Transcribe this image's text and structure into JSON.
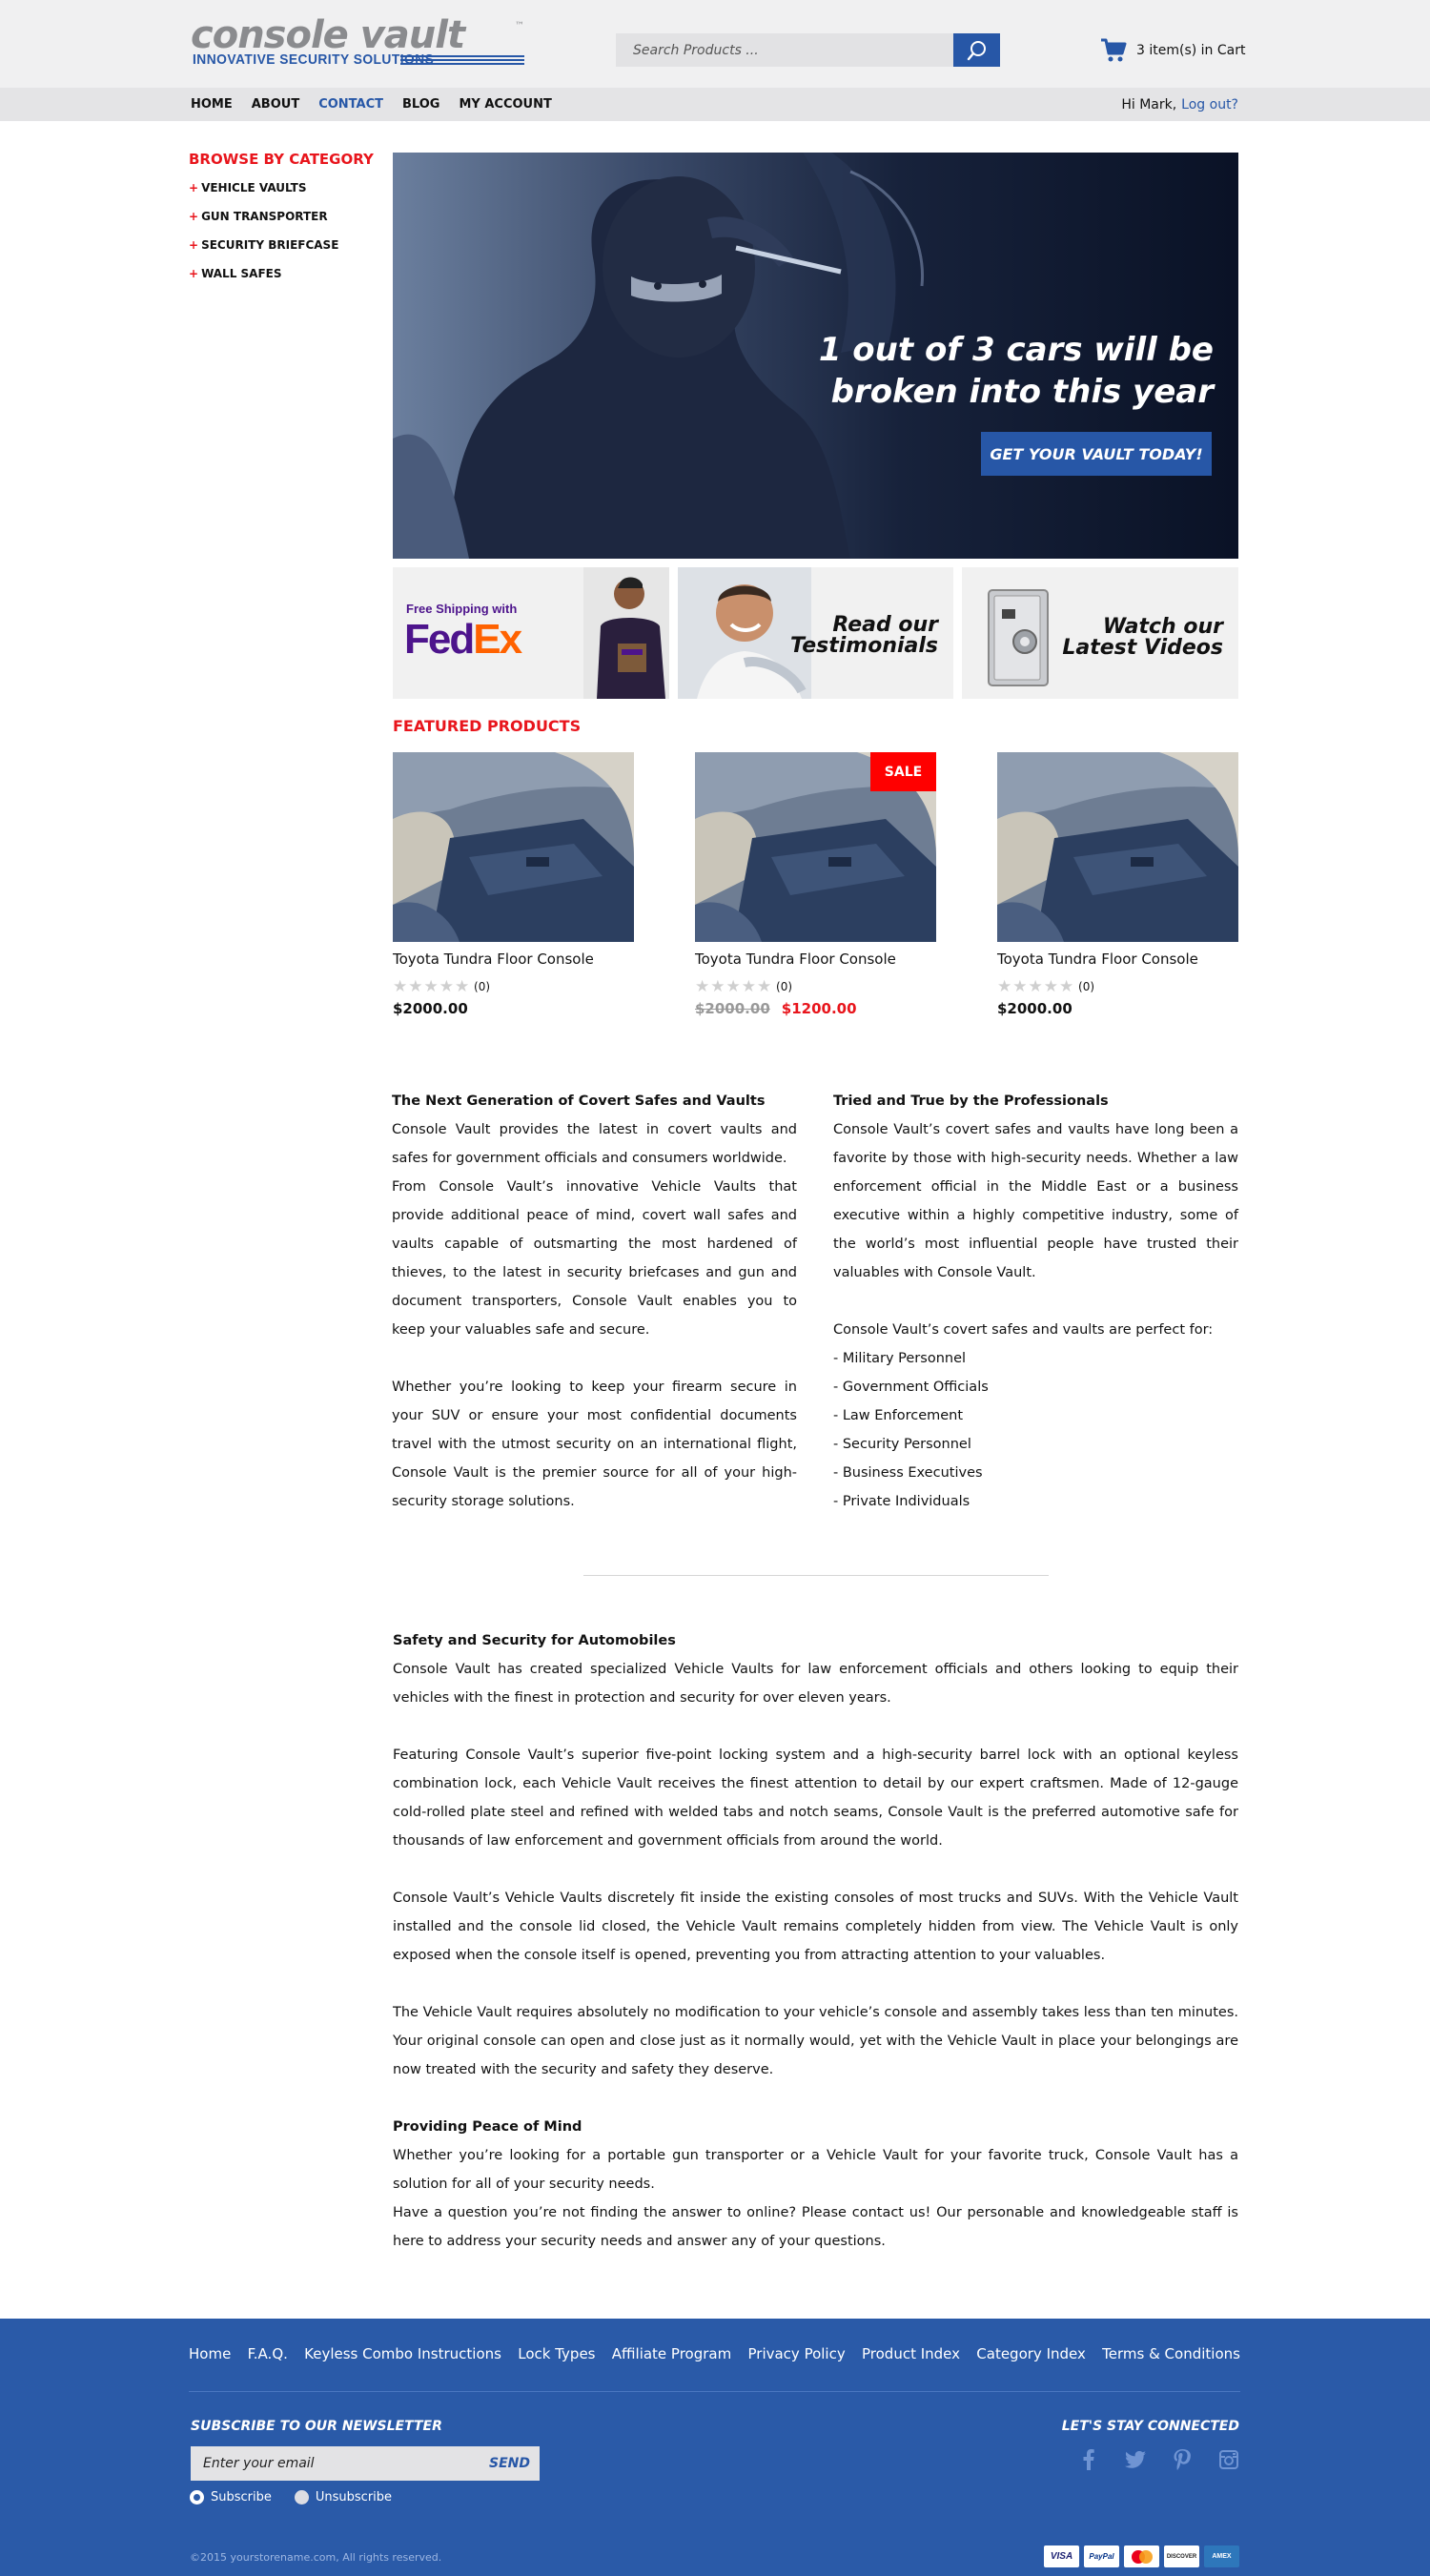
{
  "brand": {
    "name": "console vault",
    "tm": "™",
    "tagline": "INNOVATIVE SECURITY SOLUTIONS",
    "accent": "#2757a7",
    "red": "#e8151c"
  },
  "search": {
    "placeholder": "Search Products ..."
  },
  "cart": {
    "label": "3 item(s) in Cart"
  },
  "nav": {
    "items": [
      {
        "label": "HOME"
      },
      {
        "label": "ABOUT"
      },
      {
        "label": "CONTACT"
      },
      {
        "label": "BLOG"
      },
      {
        "label": "MY ACCOUNT"
      }
    ],
    "active": "CONTACT",
    "greeting": "Hi Mark,",
    "logout": "Log out?"
  },
  "sidebar": {
    "title": "BROWSE BY CATEGORY",
    "items": [
      {
        "label": "VEHICLE VAULTS"
      },
      {
        "label": "GUN TRANSPORTER"
      },
      {
        "label": "SECURITY BRIEFCASE"
      },
      {
        "label": "WALL SAFES"
      }
    ]
  },
  "hero": {
    "headline_1": "1 out of 3 cars will be",
    "headline_2": "broken into this year",
    "cta": "GET YOUR VAULT TODAY!"
  },
  "promos": {
    "fedex_small": "Free Shipping with",
    "fedex_fe": "Fed",
    "fedex_ex": "Ex",
    "testimonials_1": "Read our",
    "testimonials_2": "Testimonials",
    "videos_1": "Watch our",
    "videos_2": "Latest Videos"
  },
  "featured": {
    "title": "FEATURED PRODUCTS",
    "products": [
      {
        "name": "Toyota Tundra Floor Console",
        "reviews": "(0)",
        "rating": 0,
        "price": "$2000.00"
      },
      {
        "name": "Toyota Tundra Floor Console",
        "reviews": "(0)",
        "rating": 0,
        "old_price": "$2000.00",
        "sale_price": "$1200.00",
        "badge": "SALE"
      },
      {
        "name": "Toyota Tundra Floor Console",
        "reviews": "(0)",
        "rating": 0,
        "price": "$2000.00"
      }
    ]
  },
  "content": {
    "left": {
      "heading": "The Next Generation of Covert Safes and Vaults",
      "p1": "Console Vault provides the latest in covert vaults and safes for government officials and consumers worldwide.",
      "p2": "From Console Vault’s innovative Vehicle Vaults that provide additional peace of mind, covert wall safes and vaults capable of outsmarting the most hardened of thieves, to the latest in security briefcases and gun and document transporters, Console Vault enables you to keep your valuables safe and secure.",
      "p3": "Whether you’re looking to keep your firearm secure in your SUV or ensure your most confidential documents travel with the utmost security on an international flight, Console Vault is the premier source for all of your high-security storage solutions."
    },
    "right": {
      "heading": "Tried and True by the Professionals",
      "p1": "Console Vault’s covert safes and vaults have long been a favorite by those with high-security needs. Whether a law enforcement official in the Middle East or a business executive within a highly competitive industry, some of the world’s most influential people have trusted their valuables with Console Vault.",
      "p2": "Console Vault’s covert safes and vaults are perfect for:",
      "list": [
        "- Military Personnel",
        "- Government Officials",
        "- Law Enforcement",
        "- Security Personnel",
        "- Business Executives",
        "- Private Individuals"
      ]
    },
    "auto": {
      "heading": "Safety and Security for Automobiles",
      "p1": "Console Vault has created specialized Vehicle Vaults for law enforcement officials and others looking to equip their vehicles with the finest in protection and security for over eleven years.",
      "p2": "Featuring Console Vault’s superior five-point locking system and a high-security barrel lock with an optional keyless combination lock, each Vehicle Vault receives the finest attention to detail by our expert craftsmen. Made of 12-gauge cold-rolled plate steel and refined with welded tabs and notch seams, Console Vault is the preferred automotive safe for thousands of law enforcement and government officials from around the world.",
      "p3": "Console Vault’s Vehicle Vaults discretely fit inside the existing consoles of most trucks and SUVs. With the Vehicle Vault installed and the console lid closed, the Vehicle Vault remains completely hidden from view. The Vehicle Vault is only exposed when the console itself is opened, preventing you from attracting attention to your valuables.",
      "p4": "The Vehicle Vault requires absolutely no modification to your vehicle’s console and assembly takes less than ten minutes. Your original console can open and close just as it normally would, yet with the Vehicle Vault in place your belongings are now treated with the security and safety they deserve."
    },
    "peace": {
      "heading": "Providing Peace of Mind",
      "p1": "Whether you’re looking for a portable gun transporter or a Vehicle Vault for your favorite truck, Console Vault has a solution for all of your security needs.",
      "p2": "Have a question you’re not finding the answer to online? Please contact us! Our personable and knowledgeable staff is here to address your security needs and answer any of your questions."
    }
  },
  "footer": {
    "links": [
      {
        "label": "Home"
      },
      {
        "label": "F.A.Q."
      },
      {
        "label": "Keyless Combo Instructions"
      },
      {
        "label": "Lock Types"
      },
      {
        "label": "Affiliate Program"
      },
      {
        "label": "Privacy Policy"
      },
      {
        "label": "Product Index"
      },
      {
        "label": "Category Index"
      },
      {
        "label": "Terms & Conditions"
      }
    ],
    "newsletter_title": "SUBSCRIBE TO OUR NEWSLETTER",
    "email_placeholder": "Enter your email",
    "send": "SEND",
    "subscribe": "Subscribe",
    "unsubscribe": "Unsubscribe",
    "subscribe_selected": true,
    "stay_connected": "LET'S STAY CONNECTED",
    "social": [
      "facebook-icon",
      "twitter-icon",
      "pinterest-icon",
      "instagram-icon"
    ],
    "copyright": "©2015  yourstorename.com, All rights reserved.",
    "cards": [
      "VISA",
      "PayPal",
      "MC",
      "DISCOVER",
      "AMEX"
    ],
    "background": "#2a5aa8"
  }
}
